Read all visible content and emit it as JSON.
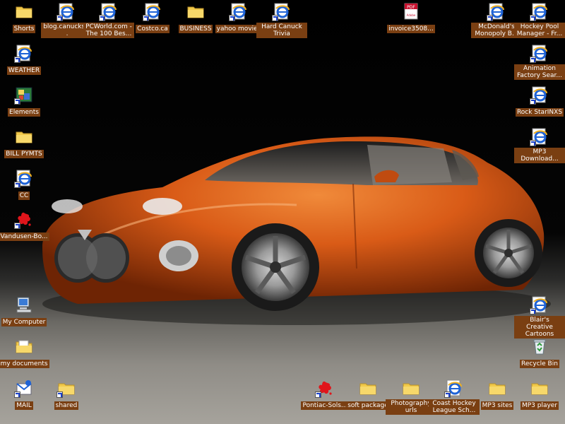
{
  "desktop": {
    "icons": [
      {
        "label": "Shorts",
        "icon": "folder-icon"
      },
      {
        "label": "blog.canucks....",
        "icon": "ie-shortcut-icon"
      },
      {
        "label": "PCWorld.com - The 100 Bes...",
        "icon": "ie-shortcut-icon"
      },
      {
        "label": "Costco.ca",
        "icon": "ie-shortcut-icon"
      },
      {
        "label": "BUSINESS",
        "icon": "folder-icon"
      },
      {
        "label": "yahoo movies",
        "icon": "ie-shortcut-icon"
      },
      {
        "label": "Hard Canuck Trivia",
        "icon": "ie-shortcut-icon"
      },
      {
        "label": "invoice3508...",
        "icon": "pdf-icon"
      },
      {
        "label": "McDonald's Monopoly B...",
        "icon": "ie-shortcut-icon"
      },
      {
        "label": "Hockey Pool Manager - Fr...",
        "icon": "ie-shortcut-icon"
      },
      {
        "label": "WEATHER",
        "icon": "ie-shortcut-icon"
      },
      {
        "label": "Animation Factory Sear...",
        "icon": "ie-shortcut-icon"
      },
      {
        "label": "Elements",
        "icon": "elements-app-icon"
      },
      {
        "label": "Rock StarINXS",
        "icon": "ie-shortcut-icon"
      },
      {
        "label": "BILL PYMTS",
        "icon": "folder-icon"
      },
      {
        "label": "MP3 Download...",
        "icon": "ie-shortcut-icon"
      },
      {
        "label": "CC",
        "icon": "ie-shortcut-icon"
      },
      {
        "label": "Vandusen-Bo...",
        "icon": "red-splash-icon"
      },
      {
        "label": "My Computer",
        "icon": "computer-icon"
      },
      {
        "label": "Blair's Creative Cartoons",
        "icon": "ie-shortcut-icon"
      },
      {
        "label": "my documents",
        "icon": "folder-icon"
      },
      {
        "label": "Recycle Bin",
        "icon": "recycle-bin-icon"
      },
      {
        "label": "MAIL",
        "icon": "mail-shortcut-icon"
      },
      {
        "label": "shared",
        "icon": "folder-icon"
      },
      {
        "label": "Pontiac-Sols...",
        "icon": "red-splash-icon"
      },
      {
        "label": "soft package",
        "icon": "folder-icon"
      },
      {
        "label": "Photography urls",
        "icon": "folder-icon"
      },
      {
        "label": "Coast Hockey League Sch...",
        "icon": "ie-shortcut-icon"
      },
      {
        "label": "MP3 sites",
        "icon": "folder-icon"
      },
      {
        "label": "MP3 player",
        "icon": "folder-icon"
      }
    ],
    "pdf_badge": "PDF",
    "pdf_subbadge": "Adobe"
  },
  "colors": {
    "label_bg": "#7a3f12",
    "car_body": "#d95b17",
    "folder": "#f1c94a",
    "ie_blue": "#1f63d6"
  }
}
